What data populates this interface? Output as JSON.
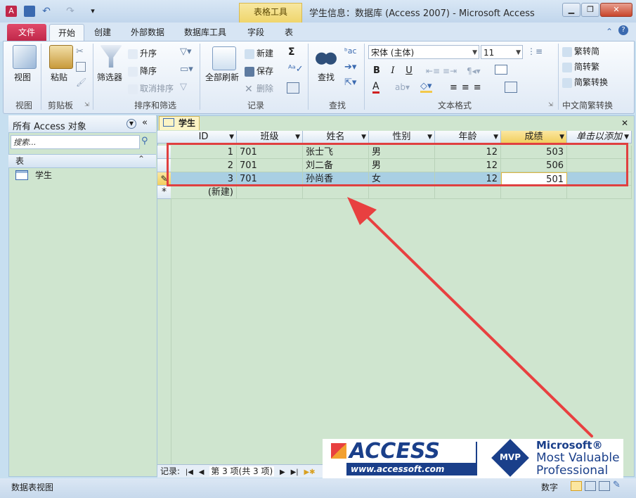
{
  "title_bar": {
    "window_title": "学生信息：数据库 (Access 2007)  -  Microsoft Access",
    "contextual_tab_group": "表格工具",
    "qat_customize": "▾"
  },
  "tabs": [
    "文件",
    "开始",
    "创建",
    "外部数据",
    "数据库工具",
    "字段",
    "表"
  ],
  "ribbon": {
    "view": {
      "button": "视图",
      "group": "视图"
    },
    "clipboard": {
      "paste": "粘贴",
      "group": "剪贴板"
    },
    "sort_filter": {
      "filter": "筛选器",
      "asc": "升序",
      "desc": "降序",
      "clear_sort": "取消排序",
      "group": "排序和筛选"
    },
    "records": {
      "refresh_all": "全部刷新",
      "new": "新建",
      "save": "保存",
      "delete": "删除",
      "totals": "Σ",
      "group": "记录"
    },
    "find": {
      "find": "查找",
      "group": "查找"
    },
    "text_format": {
      "font": "宋体 (主体)",
      "size": "11",
      "bold": "B",
      "italic": "I",
      "underline": "U",
      "group": "文本格式"
    },
    "chinese_convert": {
      "to_simplified": "繁转简",
      "to_traditional": "简转繁",
      "convert": "简繁转换",
      "group": "中文简繁转换"
    }
  },
  "nav_pane": {
    "title": "所有 Access 对象",
    "search_placeholder": "搜索...",
    "section": "表",
    "items": [
      "学生"
    ]
  },
  "datasheet": {
    "tab": "学生",
    "columns": [
      "ID",
      "班级",
      "姓名",
      "性别",
      "年龄",
      "成绩",
      "单击以添加"
    ],
    "rows": [
      {
        "id": "1",
        "class": "701",
        "name": "张士飞",
        "gender": "男",
        "age": "12",
        "score": "503"
      },
      {
        "id": "2",
        "class": "701",
        "name": "刘二备",
        "gender": "男",
        "age": "12",
        "score": "506"
      },
      {
        "id": "3",
        "class": "701",
        "name": "孙尚香",
        "gender": "女",
        "age": "12",
        "score": "501"
      }
    ],
    "new_row": "(新建)",
    "new_row_marker": "*",
    "edit_marker": "✎"
  },
  "record_nav": {
    "label": "记录:",
    "position": "第 3 项(共 3 项)"
  },
  "status_bar": {
    "left": "数据表视图",
    "right": "数字"
  },
  "watermark": {
    "brand": "ACCESS",
    "url": "www.accessoft.com",
    "mvp": "MVP",
    "ms1": "Microsoft®",
    "ms2": "Most Valuable",
    "ms3": "Professional"
  },
  "colors": {
    "datasheet_bg": "#cfe5cf",
    "selected_row": "#a9cfe3",
    "highlight_box": "#e04040",
    "arrow": "#e84040"
  }
}
